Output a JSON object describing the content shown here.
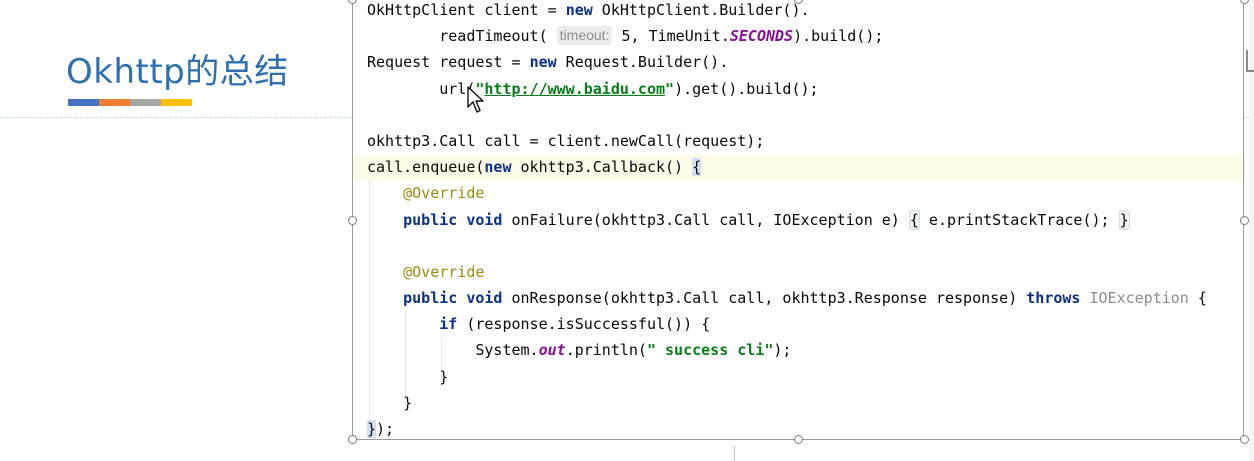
{
  "slide": {
    "title": "Okhttp的总结",
    "accent_colors": [
      "#4472c4",
      "#ed7d31",
      "#a5a5a5",
      "#ffc000"
    ],
    "title_color": "#2e6fb0"
  },
  "code": {
    "l1_a": "OkHttpClient client = ",
    "l1_kw": "new",
    "l1_b": " OkHttpClient.Builder().",
    "l2_a": "        readTimeout( ",
    "l2_hint": "timeout:",
    "l2_b": " 5, TimeUnit.",
    "l2_static": "SECONDS",
    "l2_c": ").build();",
    "l3_a": "Request request = ",
    "l3_kw": "new",
    "l3_b": " Request.Builder().",
    "l4_a": "        url(",
    "l4_q1": "\"",
    "l4_url": "http://www.baidu.com",
    "l4_q2": "\"",
    "l4_b": ").get().build();",
    "l6": "okhttp3.Call call = client.newCall(request);",
    "l7_a": "call.enqueue(",
    "l7_kw": "new",
    "l7_b": " okhttp3.Callback() ",
    "l7_brace": "{",
    "l8_ann": "    @Override",
    "l9_kw1": "public",
    "l9_kw2": "void",
    "l9_a": " onFailure(okhttp3.Call call, IOException e) ",
    "l9_open": "{",
    "l9_b": " e.printStackTrace(); ",
    "l9_close": "}",
    "l11_ann": "    @Override",
    "l12_kw1": "public",
    "l12_kw2": "void",
    "l12_a": " onResponse(okhttp3.Call call, okhttp3.Response response) ",
    "l12_throws": "throws",
    "l12_exc": " IOException",
    "l12_b": " {",
    "l13_kw": "if",
    "l13_a": " (response.isSuccessful()) {",
    "l14_a": "            System.",
    "l14_static": "out",
    "l14_b": ".println(",
    "l14_str": "\" success cli\"",
    "l14_c": ");",
    "l15": "        }",
    "l16": "    }",
    "l17_brace": "}",
    "l17_rest": ");"
  }
}
